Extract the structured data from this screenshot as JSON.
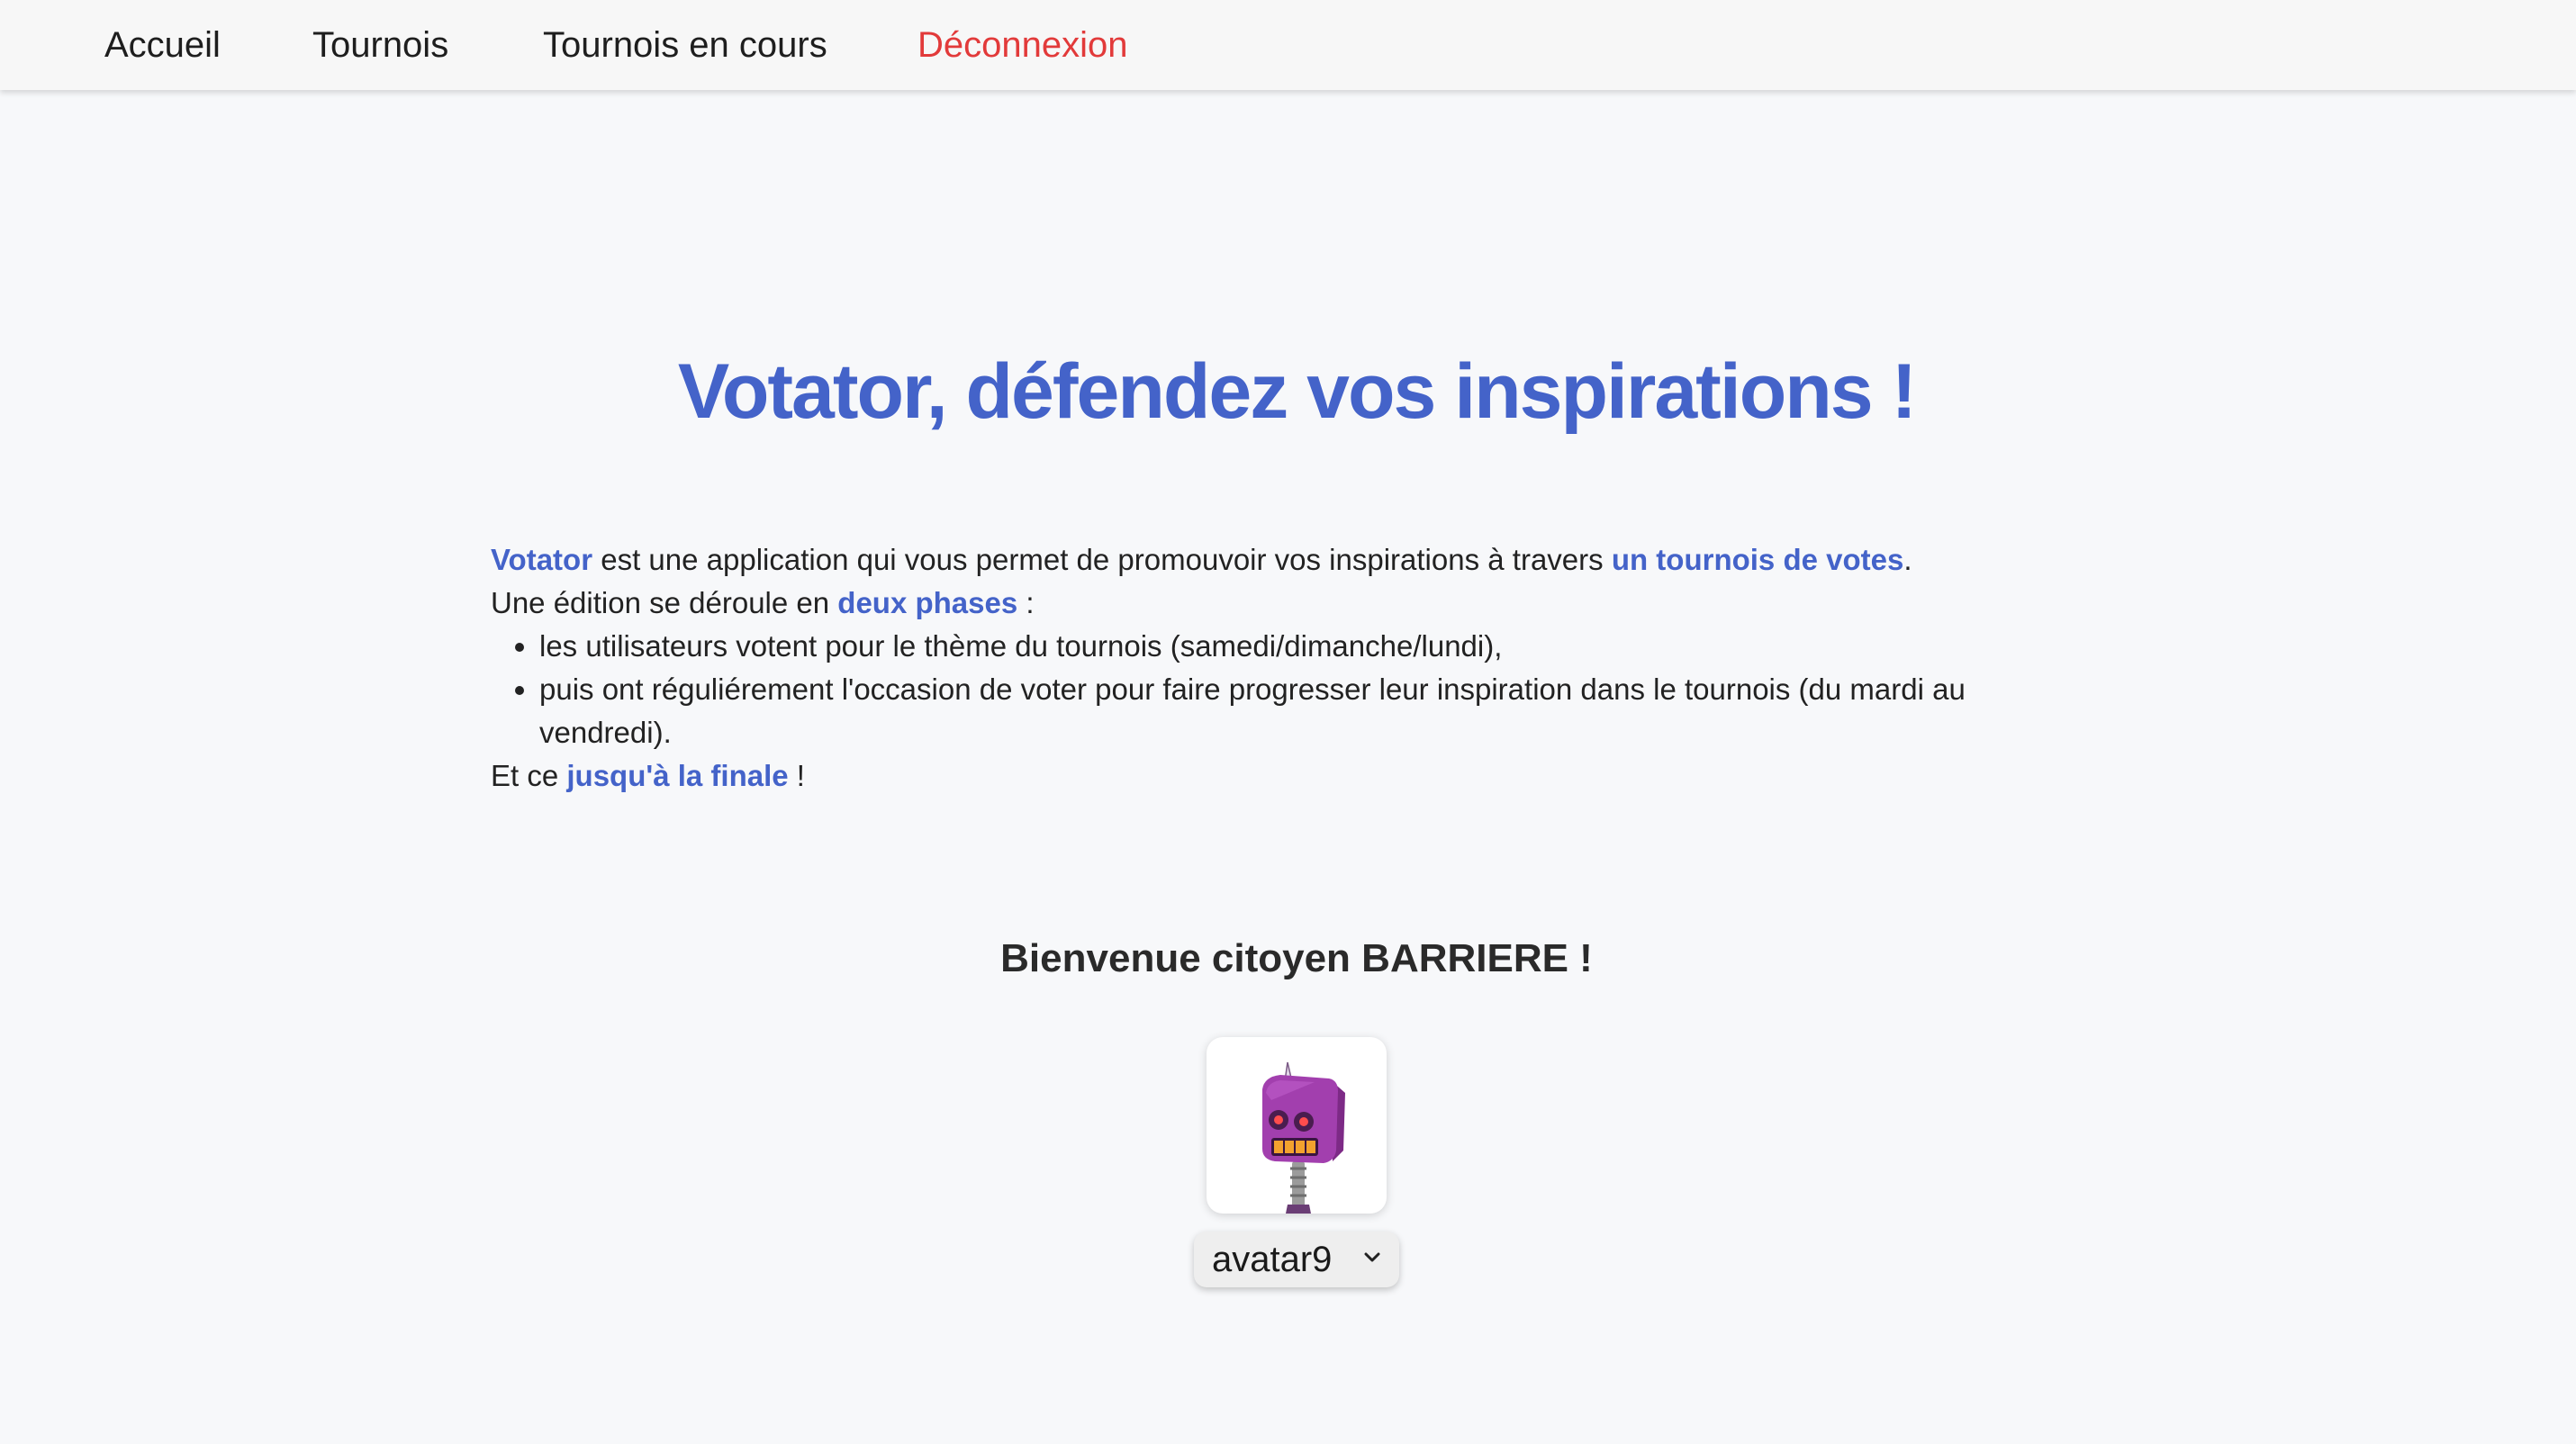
{
  "nav": {
    "home": "Accueil",
    "tournaments": "Tournois",
    "ongoing": "Tournois en cours",
    "logout": "Déconnexion"
  },
  "hero": {
    "title": "Votator, défendez vos inspirations !"
  },
  "intro": {
    "line1_brand": "Votator",
    "line1_text": " est une application qui vous permet de promouvoir vos inspirations à travers ",
    "line1_link": "un tournois de votes",
    "line1_end": ".",
    "line2_text": "Une édition se déroule en ",
    "line2_strong": "deux phases",
    "line2_end": " :",
    "bullets": [
      "les utilisateurs votent pour le thème du tournois (samedi/dimanche/lundi),",
      "puis ont réguliérement l'occasion de voter pour faire progresser leur inspiration dans le tournois (du mardi au vendredi)."
    ],
    "line3_text": "Et ce ",
    "line3_strong": "jusqu'à la finale",
    "line3_end": " !"
  },
  "welcome": {
    "text": "Bienvenue citoyen BARRIERE !"
  },
  "avatar": {
    "icon": "robot-avatar-icon",
    "selected": "avatar9"
  },
  "colors": {
    "accent": "#4463c9",
    "logout": "#e23a3a",
    "background": "#f7f8fa",
    "navbar": "#f7f7f7"
  }
}
